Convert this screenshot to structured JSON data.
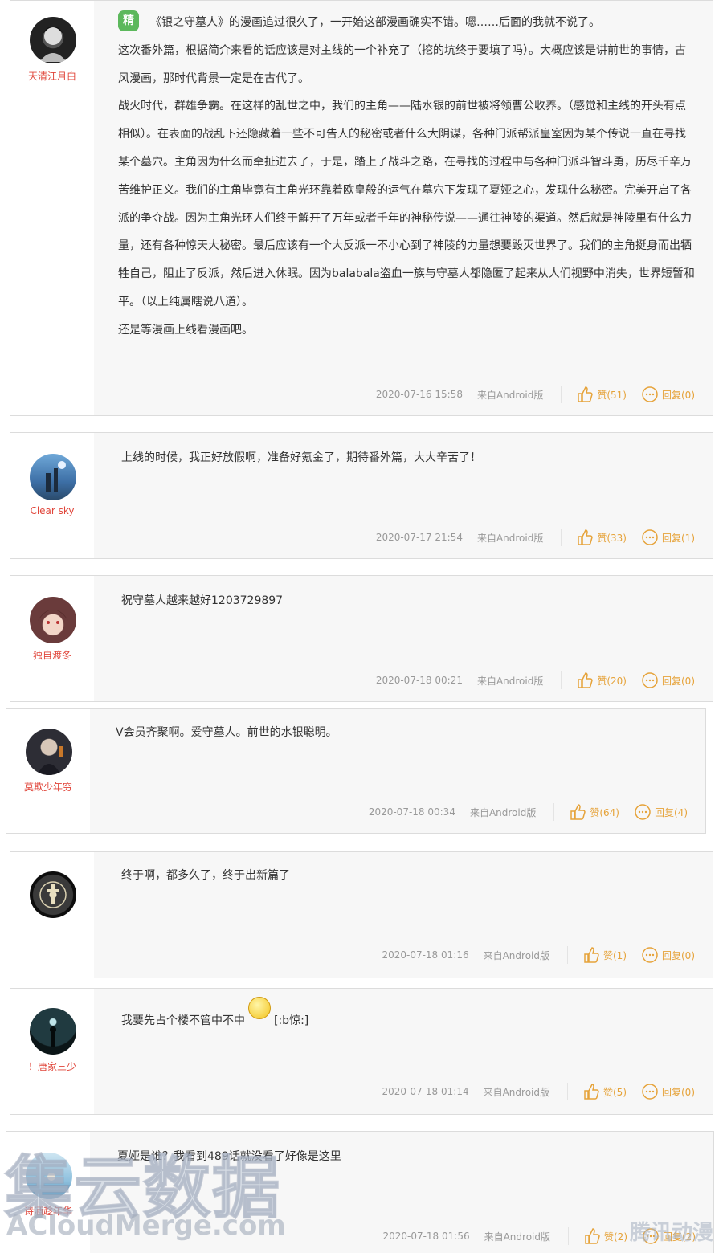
{
  "comments": [
    {
      "user": "天清江月白",
      "avatar": "avatar-icon",
      "essence_badge": "精",
      "paragraphs": [
        "《银之守墓人》的漫画追过很久了，一开始这部漫画确实不错。嗯……后面的我就不说了。",
        "这次番外篇，根据简介来看的话应该是对主线的一个补充了（挖的坑终于要填了吗）。大概应该是讲前世的事情，古风漫画，那时代背景一定是在古代了。",
        "战火时代，群雄争霸。在这样的乱世之中，我们的主角——陆水银的前世被将领曹公收养。（感觉和主线的开头有点相似）。在表面的战乱下还隐藏着一些不可告人的秘密或者什么大阴谋，各种门派帮派皇室因为某个传说一直在寻找某个墓穴。主角因为什么而牵扯进去了，于是，踏上了战斗之路，在寻找的过程中与各种门派斗智斗勇，历尽千辛万苦维护正义。我们的主角毕竟有主角光环靠着欧皇般的运气在墓穴下发现了夏娅之心，发现什么秘密。完美开启了各派的争夺战。因为主角光环人们终于解开了万年或者千年的神秘传说——通往神陵的渠道。然后就是神陵里有什么力量，还有各种惊天大秘密。最后应该有一个大反派一不小心到了神陵的力量想要毁灭世界了。我们的主角挺身而出牺牲自己，阻止了反派，然后进入休眠。因为balabala盗血一族与守墓人都隐匿了起来从人们视野中消失，世界短暂和平。（以上纯属瞎说八道）。",
        "还是等漫画上线看漫画吧。"
      ],
      "time": "2020-07-16 15:58",
      "source": "来自Android版",
      "like_label": "赞(51)",
      "reply_label": "回复(0)"
    },
    {
      "user": "Clear sky",
      "paragraphs": [
        "上线的时候，我正好放假啊，准备好氪金了，期待番外篇，大大辛苦了！"
      ],
      "time": "2020-07-17 21:54",
      "source": "来自Android版",
      "like_label": "赞(33)",
      "reply_label": "回复(1)"
    },
    {
      "user": "独自渡冬",
      "paragraphs": [
        "祝守墓人越来越好1203729897"
      ],
      "time": "2020-07-18 00:21",
      "source": "来自Android版",
      "like_label": "赞(20)",
      "reply_label": "回复(0)"
    },
    {
      "user": "莫欺少年穷",
      "paragraphs": [
        "V会员齐聚啊。爱守墓人。前世的水银聪明。"
      ],
      "time": "2020-07-18 00:34",
      "source": "来自Android版",
      "like_label": "赞(64)",
      "reply_label": "回复(4)"
    },
    {
      "user": "",
      "paragraphs": [
        "终于啊，都多久了，终于出新篇了"
      ],
      "time": "2020-07-18 01:16",
      "source": "来自Android版",
      "like_label": "赞(1)",
      "reply_label": "回复(0)"
    },
    {
      "user": "！唐家三少",
      "paragraphs": [
        "我要先占个楼不管中不中"
      ],
      "emoji_text": "[:b惊:]",
      "time": "2020-07-18 01:14",
      "source": "来自Android版",
      "like_label": "赞(5)",
      "reply_label": "回复(0)"
    },
    {
      "user": "诗酒趁年华",
      "paragraphs": [
        "夏娅是谁？我看到489话就没看了好像是这里"
      ],
      "time": "2020-07-18 01:56",
      "source": "来自Android版",
      "like_label": "赞(2)",
      "reply_label": "回复(2)"
    }
  ],
  "watermark": {
    "main": "集云数据",
    "sub": "ACloudMerge.com",
    "corner": "腾讯动漫"
  },
  "colors": {
    "username": "#e0453a",
    "action": "#e6a33a",
    "essence": "#5cb85c",
    "content_bg": "#f7f7f7"
  }
}
